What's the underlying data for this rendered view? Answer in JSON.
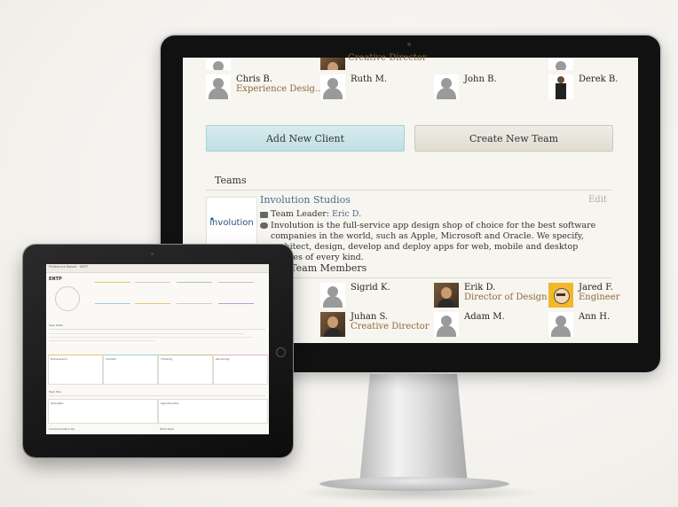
{
  "imac": {
    "partial_role": "Creative Director",
    "people_row1": [
      {
        "name": "Chris B.",
        "role": "Experience Desig..."
      },
      {
        "name": "Ruth M.",
        "role": ""
      },
      {
        "name": "John B.",
        "role": ""
      },
      {
        "name": "Derek B.",
        "role": ""
      }
    ],
    "buttons": {
      "add_client": "Add New Client",
      "create_team": "Create New Team"
    },
    "teams_heading": "Teams",
    "team": {
      "logo_text": "involution",
      "name": "Involution Studios",
      "edit": "Edit",
      "leader_label": "Team Leader:",
      "leader_name": "Eric D.",
      "description": "Involution is the full-service app design shop of choice for the best software companies in the world, such as Apple, Microsoft and Oracle. We specify, architect, design, develop and deploy apps for web, mobile and desktop devices of every kind."
    },
    "members_heading": "s Team Members",
    "members": [
      {
        "name": "Sigrid K.",
        "role": ""
      },
      {
        "name": "Erik D.",
        "role": "Director of Design ..."
      },
      {
        "name": "Jared F.",
        "role": "Engineer"
      },
      {
        "name": "Juhan S.",
        "role": "Creative Director"
      },
      {
        "name": "Adam M.",
        "role": ""
      },
      {
        "name": "Ann H.",
        "role": ""
      }
    ]
  },
  "ipad": {
    "title": "Preference Report · ENTP",
    "heading": "ENTP",
    "sections": [
      "Type Traits",
      "Type Tips",
      "Communication Tip",
      "Work Style"
    ],
    "columns": [
      "Extraversion",
      "Intuition",
      "Thinking",
      "Perceiving"
    ],
    "tips": [
      "Strengths",
      "Opportunities"
    ]
  },
  "colors": {
    "link": "#4a6a8e",
    "role": "#8a6a3a",
    "blue_button": "#c9e4ea",
    "beige_button": "#e7e3da"
  }
}
